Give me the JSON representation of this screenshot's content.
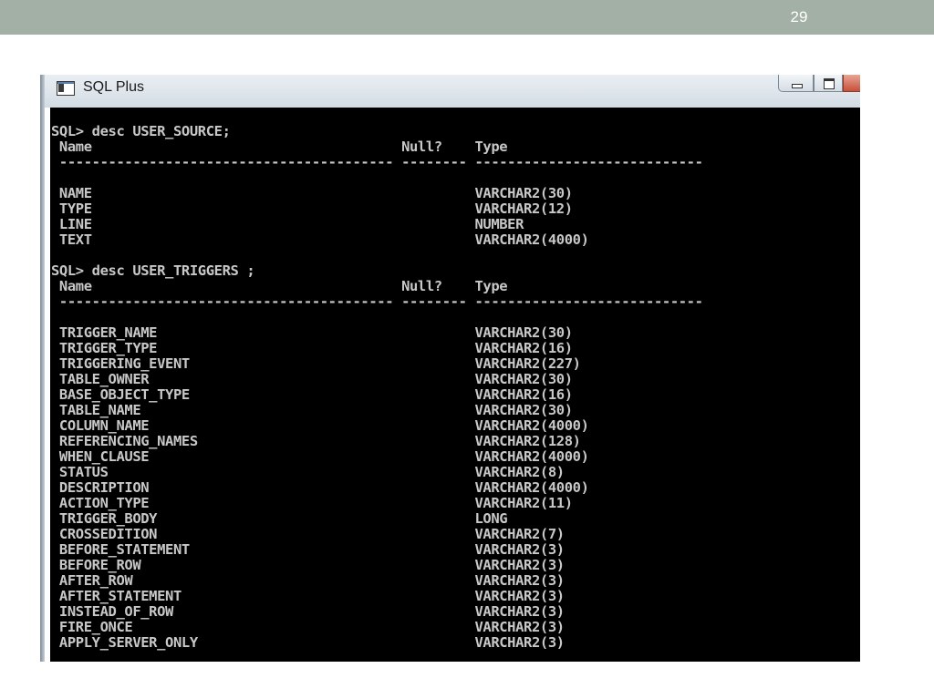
{
  "slide": {
    "number": "29"
  },
  "window": {
    "title": "SQL Plus"
  },
  "console": {
    "lines": [
      "SQL> desc USER_SOURCE;",
      " Name                                      Null?    Type",
      " ----------------------------------------- -------- ----------------------------",
      "",
      " NAME                                               VARCHAR2(30)",
      " TYPE                                               VARCHAR2(12)",
      " LINE                                               NUMBER",
      " TEXT                                               VARCHAR2(4000)",
      "",
      "SQL> desc USER_TRIGGERS ;",
      " Name                                      Null?    Type",
      " ----------------------------------------- -------- ----------------------------",
      "",
      " TRIGGER_NAME                                       VARCHAR2(30)",
      " TRIGGER_TYPE                                       VARCHAR2(16)",
      " TRIGGERING_EVENT                                   VARCHAR2(227)",
      " TABLE_OWNER                                        VARCHAR2(30)",
      " BASE_OBJECT_TYPE                                   VARCHAR2(16)",
      " TABLE_NAME                                         VARCHAR2(30)",
      " COLUMN_NAME                                        VARCHAR2(4000)",
      " REFERENCING_NAMES                                  VARCHAR2(128)",
      " WHEN_CLAUSE                                        VARCHAR2(4000)",
      " STATUS                                             VARCHAR2(8)",
      " DESCRIPTION                                        VARCHAR2(4000)",
      " ACTION_TYPE                                        VARCHAR2(11)",
      " TRIGGER_BODY                                       LONG",
      " CROSSEDITION                                       VARCHAR2(7)",
      " BEFORE_STATEMENT                                   VARCHAR2(3)",
      " BEFORE_ROW                                         VARCHAR2(3)",
      " AFTER_ROW                                          VARCHAR2(3)",
      " AFTER_STATEMENT                                    VARCHAR2(3)",
      " INSTEAD_OF_ROW                                     VARCHAR2(3)",
      " FIRE_ONCE                                          VARCHAR2(3)",
      " APPLY_SERVER_ONLY                                  VARCHAR2(3)"
    ]
  }
}
